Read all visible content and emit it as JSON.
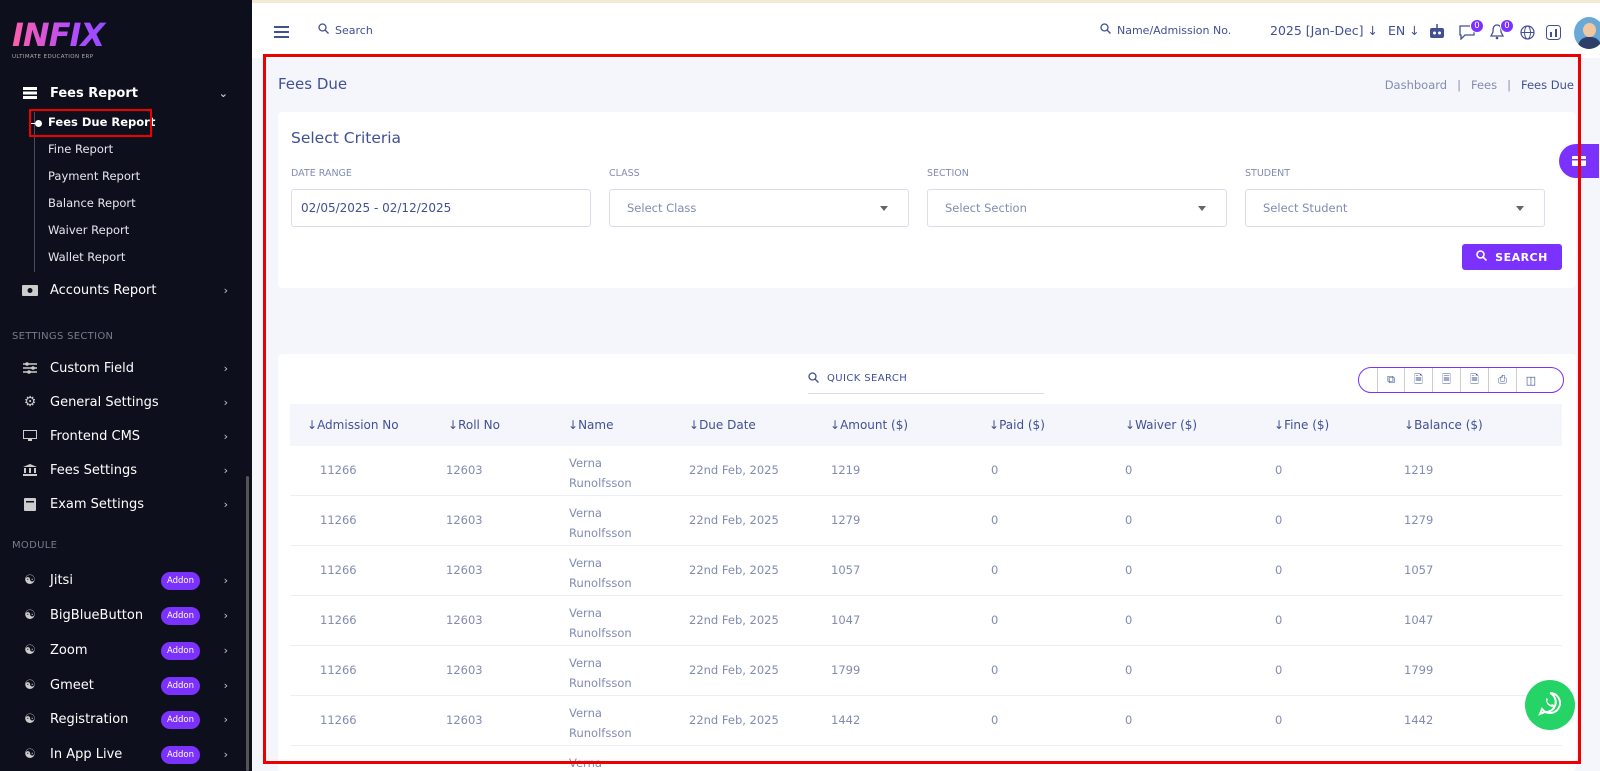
{
  "brand": {
    "logo": "INFIX",
    "tagline": "ULTIMATE EDUCATION ERP"
  },
  "sidebar": {
    "fees_report": "Fees Report",
    "sub_items": [
      "Fees Due Report",
      "Fine Report",
      "Payment Report",
      "Balance Report",
      "Waiver Report",
      "Wallet Report"
    ],
    "accounts_report": "Accounts Report",
    "settings_section": "SETTINGS SECTION",
    "settings_items": [
      "Custom Field",
      "General Settings",
      "Frontend CMS",
      "Fees Settings",
      "Exam Settings"
    ],
    "module_section": "MODULE",
    "module_items": [
      "Jitsi",
      "BigBlueButton",
      "Zoom",
      "Gmeet",
      "Registration",
      "In App Live"
    ],
    "addon_label": "Addon"
  },
  "topbar": {
    "search": "Search",
    "name_search": "Name/Admission No.",
    "year": "2025 [Jan-Dec]",
    "lang": "EN",
    "messages_count": "0",
    "notifications_count": "0"
  },
  "page": {
    "title": "Fees Due",
    "breadcrumb": [
      "Dashboard",
      "Fees",
      "Fees Due"
    ]
  },
  "criteria": {
    "title": "Select Criteria",
    "date_range_label": "DATE RANGE",
    "date_range_value": "02/05/2025 - 02/12/2025",
    "class_label": "CLASS",
    "class_placeholder": "Select Class",
    "section_label": "SECTION",
    "section_placeholder": "Select Section",
    "student_label": "STUDENT",
    "student_placeholder": "Select Student",
    "search_button": "SEARCH"
  },
  "table": {
    "quick_search": "QUICK SEARCH",
    "columns": [
      "Admission No",
      "Roll No",
      "Name",
      "Due Date",
      "Amount ($)",
      "Paid ($)",
      "Waiver ($)",
      "Fine ($)",
      "Balance ($)"
    ],
    "rows": [
      {
        "admission": "11266",
        "roll": "12603",
        "first": "Verna",
        "last": "Runolfsson",
        "due": "22nd Feb, 2025",
        "amount": "1219",
        "paid": "0",
        "waiver": "0",
        "fine": "0",
        "balance": "1219"
      },
      {
        "admission": "11266",
        "roll": "12603",
        "first": "Verna",
        "last": "Runolfsson",
        "due": "22nd Feb, 2025",
        "amount": "1279",
        "paid": "0",
        "waiver": "0",
        "fine": "0",
        "balance": "1279"
      },
      {
        "admission": "11266",
        "roll": "12603",
        "first": "Verna",
        "last": "Runolfsson",
        "due": "22nd Feb, 2025",
        "amount": "1057",
        "paid": "0",
        "waiver": "0",
        "fine": "0",
        "balance": "1057"
      },
      {
        "admission": "11266",
        "roll": "12603",
        "first": "Verna",
        "last": "Runolfsson",
        "due": "22nd Feb, 2025",
        "amount": "1047",
        "paid": "0",
        "waiver": "0",
        "fine": "0",
        "balance": "1047"
      },
      {
        "admission": "11266",
        "roll": "12603",
        "first": "Verna",
        "last": "Runolfsson",
        "due": "22nd Feb, 2025",
        "amount": "1799",
        "paid": "0",
        "waiver": "0",
        "fine": "0",
        "balance": "1799"
      },
      {
        "admission": "11266",
        "roll": "12603",
        "first": "Verna",
        "last": "Runolfsson",
        "due": "22nd Feb, 2025",
        "amount": "1442",
        "paid": "0",
        "waiver": "0",
        "fine": "0",
        "balance": "1442"
      },
      {
        "first": "Verna"
      }
    ]
  },
  "colors": {
    "accent": "#7c32ff",
    "sidebar_bg": "#0e0f1c",
    "text": "#415094",
    "muted": "#828bb2",
    "highlight": "#e00000"
  }
}
